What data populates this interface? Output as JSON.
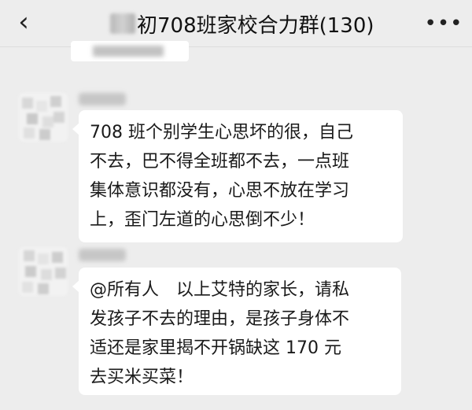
{
  "header": {
    "back_icon": "chevron-left-icon",
    "title": "初708班家校合力群(130)",
    "more_icon": "more-dots-icon"
  },
  "messages": [
    {
      "lines": [
        "708 班个别学生心思坏的很，自己",
        "不去，巴不得全班都不去，一点班",
        "集体意识都没有，心思不放在学习",
        "上，歪门左道的心思倒不少！"
      ]
    },
    {
      "lines": [
        "@所有人　以上艾特的家长，请私",
        "发孩子不去的理由，是孩子身体不",
        "适还是家里揭不开锅缺这 170 元",
        "去买米买菜！"
      ]
    }
  ]
}
